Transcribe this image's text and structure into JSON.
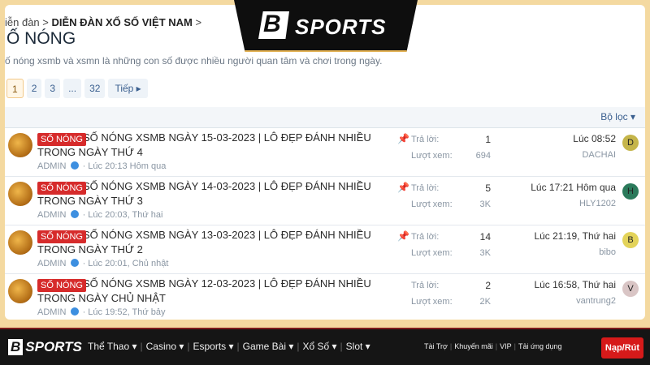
{
  "breadcrumb": {
    "prefix": "iễn đàn",
    "sep": ">",
    "current": "DIỄN ĐÀN XỔ SỐ VIỆT NAM",
    "tail": ">"
  },
  "page_title": "Ố NÓNG",
  "description": "ố nóng xsmb và xsmn là những con số được nhiều người quan tâm và chơi trong ngày.",
  "pager": {
    "pages": [
      "1",
      "2",
      "3",
      "...",
      "32"
    ],
    "active": "1",
    "next": "Tiếp ▸"
  },
  "filter_label": "Bộ lọc ▾",
  "labels": {
    "replies": "Trả lời:",
    "views": "Lượt xem:",
    "tag": "SỐ NÓNG",
    "author": "ADMIN"
  },
  "threads": [
    {
      "title": "SỐ NÓNG XSMB NGÀY 15-03-2023 | LÔ ĐẸP ĐÁNH NHIỀU TRONG NGÀY THỨ 4",
      "time": "· Lúc 20:13 Hôm qua",
      "replies": "1",
      "views": "694",
      "last_time": "Lúc 08:52",
      "last_user": "DACHAI",
      "user_initial": "D",
      "user_color": "#c5b54a",
      "pinned": true
    },
    {
      "title": "SỐ NÓNG XSMB NGÀY 14-03-2023 | LÔ ĐẸP ĐÁNH NHIỀU TRONG NGÀY THỨ 3",
      "time": "· Lúc 20:03, Thứ hai",
      "replies": "5",
      "views": "3K",
      "last_time": "Lúc 17:21 Hôm qua",
      "last_user": "HLY1202",
      "user_initial": "H",
      "user_color": "#2b7a5b",
      "pinned": true
    },
    {
      "title": "SỐ NÓNG XSMB NGÀY 13-03-2023 | LÔ ĐẸP ĐÁNH NHIỀU TRONG NGÀY THỨ 2",
      "time": "· Lúc 20:01, Chủ nhật",
      "replies": "14",
      "views": "3K",
      "last_time": "Lúc 21:19, Thứ hai",
      "last_user": "bibo",
      "user_initial": "B",
      "user_color": "#e3d35a",
      "pinned": true
    },
    {
      "title": "SỐ NÓNG XSMB NGÀY 12-03-2023 | LÔ ĐẸP ĐÁNH NHIỀU TRONG NGÀY CHỦ NHẬT",
      "time": "· Lúc 19:52, Thứ bảy",
      "replies": "2",
      "views": "2K",
      "last_time": "Lúc 16:58, Thứ hai",
      "last_user": "vantrung2",
      "user_initial": "V",
      "user_color": "#d9c5c5",
      "pinned": false
    }
  ],
  "brand": {
    "logo_b": "B",
    "logo_text": "SPORTS",
    "bottom_logo_text": "SPORTS"
  },
  "bottom_nav": [
    "Thể Thao ▾",
    "Casino ▾",
    "Esports ▾",
    "Game Bài ▾",
    "Xổ Số ▾",
    "Slot ▾"
  ],
  "bottom_links": [
    "Tài Trợ",
    "Khuyến mãi",
    "VIP",
    "Tải ứng dụng"
  ],
  "cta": "Nạp/Rút"
}
